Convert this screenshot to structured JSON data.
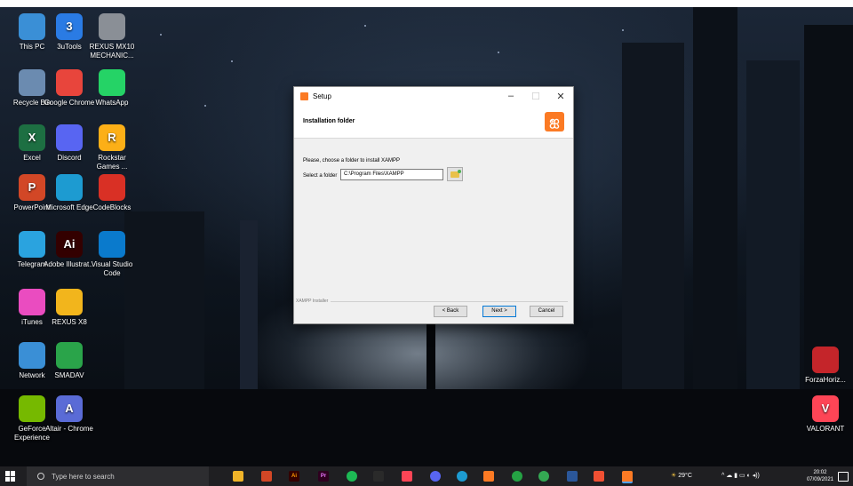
{
  "desktop": {
    "icons": [
      {
        "label": "This PC",
        "glyph": "",
        "color": "#3a8fd6"
      },
      {
        "label": "3uTools",
        "glyph": "3",
        "color": "#2a7be4"
      },
      {
        "label": "REXUS MX10 MECHANIC...",
        "glyph": "",
        "color": "#8a8f96"
      },
      {
        "label": "Recycle Bin",
        "glyph": "",
        "color": "#6b8bb0"
      },
      {
        "label": "Google Chrome",
        "glyph": "",
        "color": "#e8453c"
      },
      {
        "label": "WhatsApp",
        "glyph": "",
        "color": "#25d366"
      },
      {
        "label": "Excel",
        "glyph": "X",
        "color": "#1d6f42"
      },
      {
        "label": "Discord",
        "glyph": "",
        "color": "#5865f2"
      },
      {
        "label": "Rockstar Games ...",
        "glyph": "R",
        "color": "#fcaf17"
      },
      {
        "label": "PowerPoint",
        "glyph": "P",
        "color": "#d24726"
      },
      {
        "label": "Microsoft Edge",
        "glyph": "",
        "color": "#1d9bd1"
      },
      {
        "label": "CodeBlocks",
        "glyph": "",
        "color": "#d93025"
      },
      {
        "label": "Telegram",
        "glyph": "",
        "color": "#2aa3df"
      },
      {
        "label": "Adobe Illustrat...",
        "glyph": "Ai",
        "color": "#330000"
      },
      {
        "label": "Visual Studio Code",
        "glyph": "",
        "color": "#0a7acc"
      },
      {
        "label": "iTunes",
        "glyph": "",
        "color": "#ea4cc0"
      },
      {
        "label": "REXUS X8",
        "glyph": "",
        "color": "#f2b51c"
      },
      {
        "label": "Network",
        "glyph": "",
        "color": "#3a8fd6"
      },
      {
        "label": "SMADAV",
        "glyph": "",
        "color": "#2aa44a"
      },
      {
        "label": "GeForce Experience",
        "glyph": "",
        "color": "#76b900"
      },
      {
        "label": "Altair - Chrome",
        "glyph": "A",
        "color": "#5a6bd6"
      },
      {
        "label": "ForzaHoriz...",
        "glyph": "",
        "color": "#c4252a"
      },
      {
        "label": "VALORANT",
        "glyph": "V",
        "color": "#fd4556"
      }
    ]
  },
  "setup": {
    "title": "Setup",
    "header": "Installation folder",
    "prompt": "Please, choose a folder to install XAMPP",
    "folder_label": "Select a folder",
    "folder_value": "C:\\Program Files\\XAMPP",
    "footer": "XAMPP Installer",
    "back": "< Back",
    "next": "Next >",
    "cancel": "Cancel",
    "logo_glyph": "ஐ",
    "accent": "#fb7a24"
  },
  "taskbar": {
    "search_placeholder": "Type here to search",
    "temperature": "29°C",
    "time": "20:02",
    "date": "07/09/2021"
  }
}
